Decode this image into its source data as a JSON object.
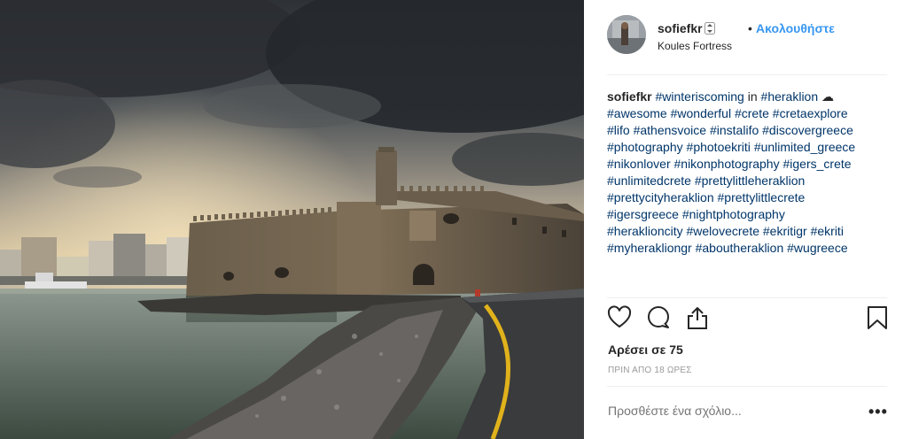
{
  "post": {
    "username": "sofiefkr",
    "follow_label": "Ακολουθήστε",
    "separator": "•",
    "location": "Koules Fortress",
    "caption": {
      "username": "sofiefkr",
      "lines": [
        [
          "#winteriscoming",
          " in ",
          "#heraklion",
          " ☁"
        ],
        [
          "#awesome",
          " ",
          "#wonderful",
          " ",
          "#crete",
          " ",
          "#cretaexplore"
        ],
        [
          "#lifo",
          " ",
          "#athensvoice",
          " ",
          "#instalifo",
          " ",
          "#discovergreece"
        ],
        [
          "#photography",
          " ",
          "#photoekriti",
          " ",
          "#unlimited_greece"
        ],
        [
          "#nikonlover",
          " ",
          "#nikonphotography",
          " ",
          "#igers_crete"
        ],
        [
          "#unlimitedcrete",
          " ",
          "#prettylittleheraklion"
        ],
        [
          "#prettycityheraklion",
          " ",
          "#prettylittlecrete"
        ],
        [
          "#igersgreece",
          " ",
          "#nightphotography"
        ],
        [
          "#heraklioncity",
          " ",
          "#welovecrete",
          " ",
          "#ekritigr",
          " ",
          "#ekriti"
        ],
        [
          "#myherakliongr",
          " ",
          "#aboutheraklion",
          " ",
          "#wugreece"
        ]
      ]
    },
    "likes_text": "Αρέσει σε 75",
    "time_text": "ΠΡΙΝ ΑΠΟ 18 ΩΡΕΣ",
    "comment_placeholder": "Προσθέστε ένα σχόλιο...",
    "more_label": "•••",
    "icons": [
      "heart-icon",
      "comment-icon",
      "share-icon",
      "bookmark-icon",
      "verified-icon",
      "avatar"
    ]
  },
  "colors": {
    "accent": "#3897f0",
    "hashtag": "#003569",
    "text": "#262626",
    "muted": "#999999",
    "divider": "#efefef"
  }
}
